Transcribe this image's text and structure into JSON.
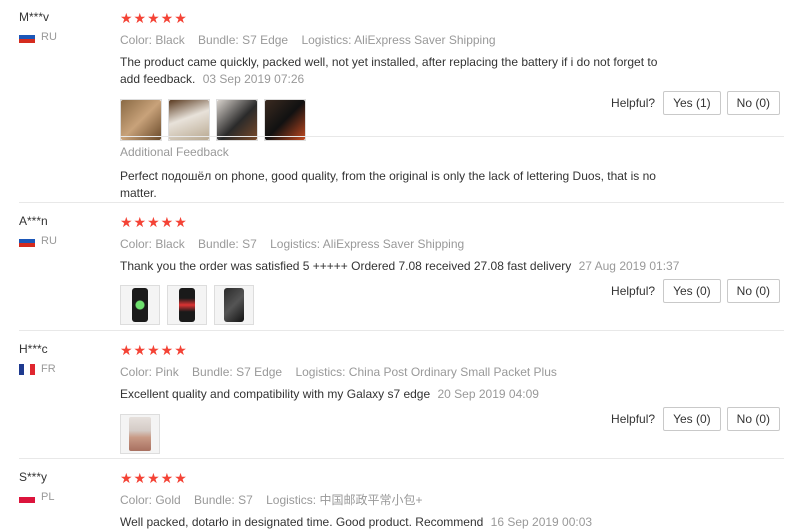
{
  "helpful_label": "Helpful?",
  "reviews": [
    {
      "user": "M***v",
      "country": "RU",
      "stars": "★★★★★",
      "color": "Color: Black",
      "bundle": "Bundle: S7 Edge",
      "logistics": "Logistics: AliExpress Saver Shipping",
      "text": "The product came quickly, packed well, not yet installed, after replacing the battery if i do not forget to add feedback.",
      "date": "03 Sep 2019 07:26",
      "yes": "Yes (1)",
      "no": "No (0)",
      "additional_label": "Additional Feedback",
      "additional_text": "Perfect подошёл on phone, good quality, from the original is only the lack of lettering Duos, that is no matter."
    },
    {
      "user": "A***n",
      "country": "RU",
      "stars": "★★★★★",
      "color": "Color: Black",
      "bundle": "Bundle: S7",
      "logistics": "Logistics: AliExpress Saver Shipping",
      "text": "Thank you the order was satisfied 5 +++++ Ordered 7.08 received 27.08 fast delivery",
      "date": "27 Aug 2019 01:37",
      "yes": "Yes (0)",
      "no": "No (0)"
    },
    {
      "user": "H***c",
      "country": "FR",
      "stars": "★★★★★",
      "color": "Color: Pink",
      "bundle": "Bundle: S7 Edge",
      "logistics": "Logistics: China Post Ordinary Small Packet Plus",
      "text": "Excellent quality and compatibility with my Galaxy s7 edge",
      "date": "20 Sep 2019 04:09",
      "yes": "Yes (0)",
      "no": "No (0)"
    },
    {
      "user": "S***y",
      "country": "PL",
      "stars": "★★★★★",
      "color": "Color: Gold",
      "bundle": "Bundle: S7",
      "logistics": "Logistics: 中国邮政平常小包+",
      "text": "Well packed, dotarło in designated time. Good product. Recommend",
      "date": "16 Sep 2019 00:03"
    }
  ]
}
